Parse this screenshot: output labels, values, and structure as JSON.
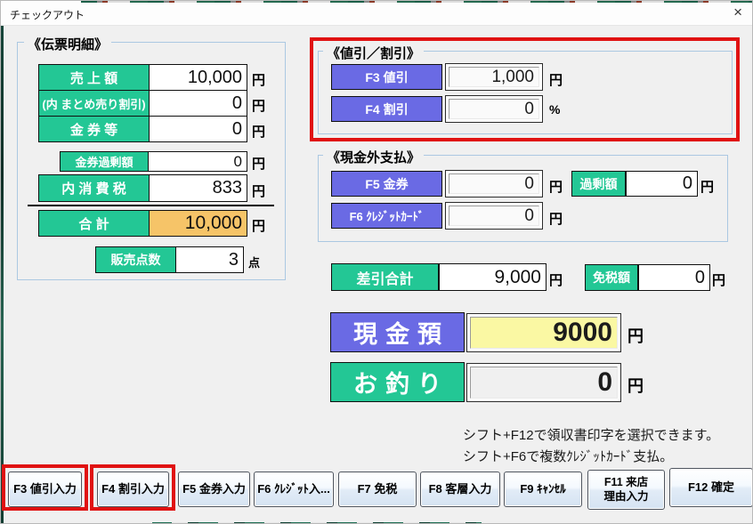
{
  "window": {
    "title": "チェックアウト",
    "close_icon": "×"
  },
  "colors": {
    "green": "#23c795",
    "blue": "#6a6ae4",
    "orange": "#f6c468",
    "yellow": "#faf8a3",
    "red": "#e01212",
    "group_line": "#abc8e2"
  },
  "slip": {
    "title": "《伝票明細》",
    "rows": [
      {
        "label": "売 上 額",
        "value": "10,000",
        "unit": "円"
      },
      {
        "label": "(内 まとめ売り割引)",
        "value": "0",
        "unit": "円"
      },
      {
        "label": "金 券 等",
        "value": "0",
        "unit": "円"
      },
      {
        "label": "金券過剰額",
        "value": "0",
        "unit": "円"
      },
      {
        "label": "内 消 費 税",
        "value": "833",
        "unit": "円"
      },
      {
        "label": "合 計",
        "value": "10,000",
        "unit": "円"
      },
      {
        "label": "販売点数",
        "value": "3",
        "unit": "点"
      }
    ]
  },
  "discount": {
    "title": "《値引／割引》",
    "f3": {
      "label": "F3 値引",
      "value": "1,000",
      "unit": "円"
    },
    "f4": {
      "label": "F4 割引",
      "value": "0",
      "unit": "%"
    }
  },
  "noncash": {
    "title": "《現金外支払》",
    "f5": {
      "label": "F5 金券",
      "value": "0",
      "unit": "円"
    },
    "excess": {
      "label": "過剰額",
      "value": "0",
      "unit": "円"
    },
    "f6": {
      "label": "F6 ｸﾚｼﾞｯﾄｶｰﾄﾞ",
      "value": "0",
      "unit": "円"
    }
  },
  "totals": {
    "net": {
      "label": "差引合計",
      "value": "9,000",
      "unit": "円"
    },
    "tax_free": {
      "label": "免税額",
      "value": "0",
      "unit": "円"
    },
    "cash": {
      "label": "現金預",
      "value": "9000",
      "unit": "円"
    },
    "change": {
      "label": "お釣り",
      "value": "0",
      "unit": "円"
    }
  },
  "hints": {
    "line1": "シフト+F12で領収書印字を選択できます。",
    "line2": "シフト+F6で複数ｸﾚｼﾞｯﾄｶｰﾄﾞ支払。"
  },
  "function_keys": [
    {
      "label": "F3 値引入力"
    },
    {
      "label": "F4 割引入力"
    },
    {
      "label": "F5 金券入力"
    },
    {
      "label": "F6 ｸﾚｼﾞｯﾄ入..."
    },
    {
      "label": "F7 免税"
    },
    {
      "label": "F8 客層入力"
    },
    {
      "label": "F9 ｷｬﾝｾﾙ"
    },
    {
      "label": "F11 来店\n理由入力"
    },
    {
      "label": "F12 確定"
    }
  ]
}
